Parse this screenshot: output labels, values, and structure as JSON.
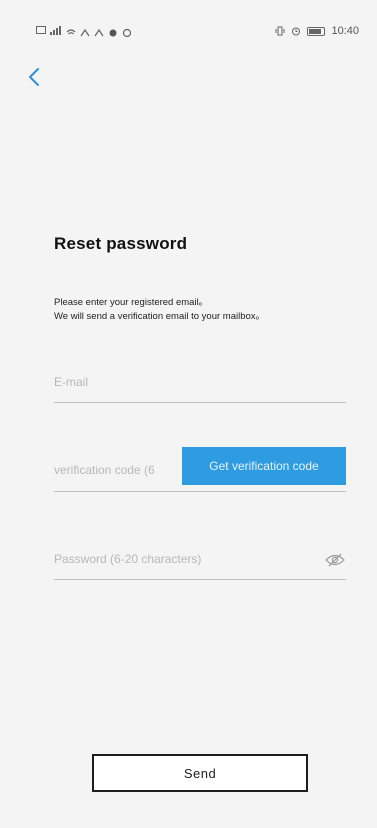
{
  "status_bar": {
    "time": "10:40"
  },
  "header": {
    "back_icon": "chevron-left-icon"
  },
  "page": {
    "title": "Reset password",
    "description_line1": "Please enter your registered email。",
    "description_line2": "We will send a verification email to your mailbox。"
  },
  "form": {
    "email_placeholder": "E-mail",
    "code_placeholder": "verification code (6",
    "get_code_label": "Get verification code",
    "password_placeholder": "Password (6-20 characters)",
    "password_toggle_icon": "eye-off-icon",
    "send_label": "Send"
  },
  "colors": {
    "accent": "#2f9be0",
    "back": "#2f8fd8",
    "background": "#f4f4f4"
  }
}
